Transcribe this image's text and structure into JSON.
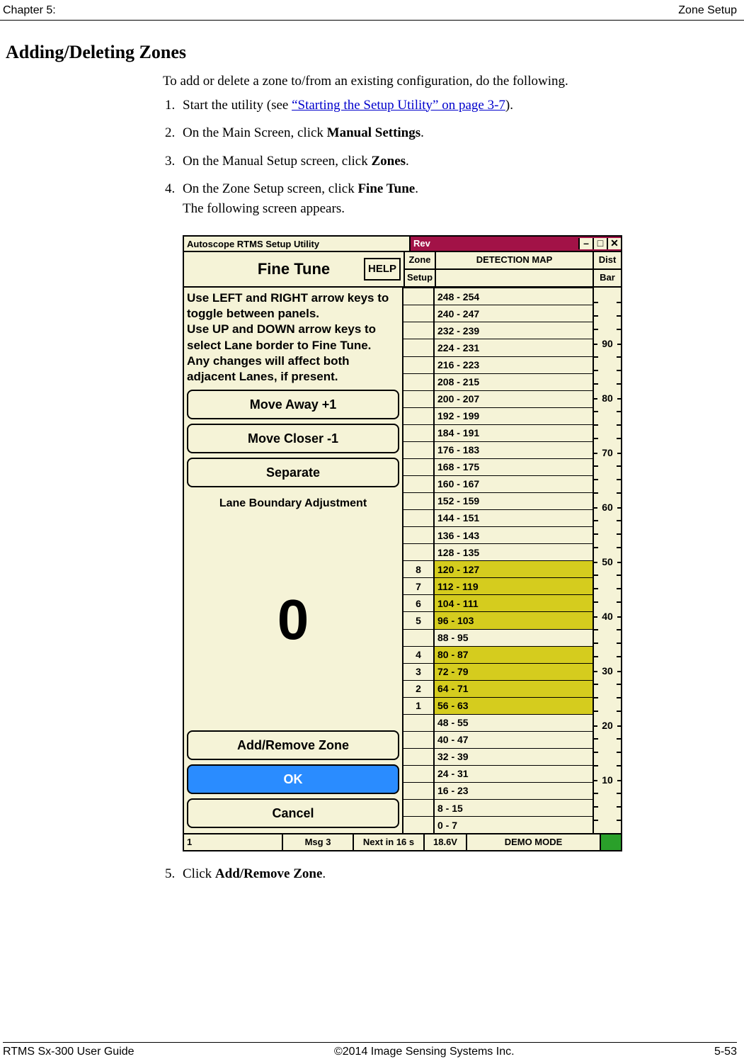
{
  "header": {
    "chapter": "Chapter 5:",
    "right": "Zone Setup"
  },
  "heading": "Adding/Deleting Zones",
  "intro": "To add or delete a zone to/from an existing configuration, do the following.",
  "steps": {
    "s1a": "Start the utility (see ",
    "s1link": "“Starting the Setup Utility” on page 3-7",
    "s1b": ").",
    "s2a": "On the Main Screen, click ",
    "s2b": "Manual Settings",
    "s2c": ".",
    "s3a": "On the Manual Setup screen, click ",
    "s3b": "Zones",
    "s3c": ".",
    "s4a": "On the Zone Setup screen, click ",
    "s4b": "Fine Tune",
    "s4c": ".",
    "s4d": "The following screen appears.",
    "s5a": "Click ",
    "s5b": "Add/Remove Zone",
    "s5c": "."
  },
  "app": {
    "title": "Autoscope RTMS Setup Utility",
    "rev": "Rev",
    "win_min": "–",
    "win_max": "□",
    "win_close": "✕",
    "fine_tune": "Fine Tune",
    "help": "HELP",
    "zone": "Zone",
    "setup": "Setup",
    "detection_map": "DETECTION MAP",
    "dist": "Dist",
    "bar": "Bar",
    "instructions": "Use LEFT and RIGHT arrow keys to toggle between panels.\nUse UP and DOWN arrow keys to select Lane border to Fine Tune.\nAny changes will affect both adjacent Lanes, if present.",
    "btn_move_away": "Move Away +1",
    "btn_move_closer": "Move Closer -1",
    "btn_separate": "Separate",
    "lba_label": "Lane Boundary Adjustment",
    "lba_value": "0",
    "btn_add_remove": "Add/Remove Zone",
    "btn_ok": "OK",
    "btn_cancel": "Cancel",
    "ranges": [
      {
        "label": "0 - 7",
        "zone": "",
        "hl": false
      },
      {
        "label": "8 - 15",
        "zone": "",
        "hl": false
      },
      {
        "label": "16 - 23",
        "zone": "",
        "hl": false
      },
      {
        "label": "24 - 31",
        "zone": "",
        "hl": false
      },
      {
        "label": "32 - 39",
        "zone": "",
        "hl": false
      },
      {
        "label": "40 - 47",
        "zone": "",
        "hl": false
      },
      {
        "label": "48 - 55",
        "zone": "",
        "hl": false
      },
      {
        "label": "56 - 63",
        "zone": "1",
        "hl": true
      },
      {
        "label": "64 - 71",
        "zone": "2",
        "hl": true
      },
      {
        "label": "72 - 79",
        "zone": "3",
        "hl": true
      },
      {
        "label": "80 - 87",
        "zone": "4",
        "hl": true
      },
      {
        "label": "88 - 95",
        "zone": "",
        "hl": false
      },
      {
        "label": "96 - 103",
        "zone": "5",
        "hl": true
      },
      {
        "label": "104 - 111",
        "zone": "6",
        "hl": true
      },
      {
        "label": "112 - 119",
        "zone": "7",
        "hl": true
      },
      {
        "label": "120 - 127",
        "zone": "8",
        "hl": true
      },
      {
        "label": "128 - 135",
        "zone": "",
        "hl": false
      },
      {
        "label": "136 - 143",
        "zone": "",
        "hl": false
      },
      {
        "label": "144 - 151",
        "zone": "",
        "hl": false
      },
      {
        "label": "152 - 159",
        "zone": "",
        "hl": false
      },
      {
        "label": "160 - 167",
        "zone": "",
        "hl": false
      },
      {
        "label": "168 - 175",
        "zone": "",
        "hl": false
      },
      {
        "label": "176 - 183",
        "zone": "",
        "hl": false
      },
      {
        "label": "184 - 191",
        "zone": "",
        "hl": false
      },
      {
        "label": "192 - 199",
        "zone": "",
        "hl": false
      },
      {
        "label": "200 - 207",
        "zone": "",
        "hl": false
      },
      {
        "label": "208 - 215",
        "zone": "",
        "hl": false
      },
      {
        "label": "216 - 223",
        "zone": "",
        "hl": false
      },
      {
        "label": "224 - 231",
        "zone": "",
        "hl": false
      },
      {
        "label": "232 - 239",
        "zone": "",
        "hl": false
      },
      {
        "label": "240 - 247",
        "zone": "",
        "hl": false
      },
      {
        "label": "248 - 254",
        "zone": "",
        "hl": false
      }
    ],
    "dist_ticks": [
      "10",
      "20",
      "30",
      "40",
      "50",
      "60",
      "70",
      "80",
      "90"
    ],
    "status": {
      "s1": "1",
      "s2": "Msg 3",
      "s3": "Next in 16 s",
      "s4": "18.6V",
      "s5": "DEMO MODE"
    }
  },
  "footer": {
    "left": "RTMS Sx-300 User Guide",
    "center": "©2014 Image Sensing Systems Inc.",
    "right": "5-53"
  }
}
